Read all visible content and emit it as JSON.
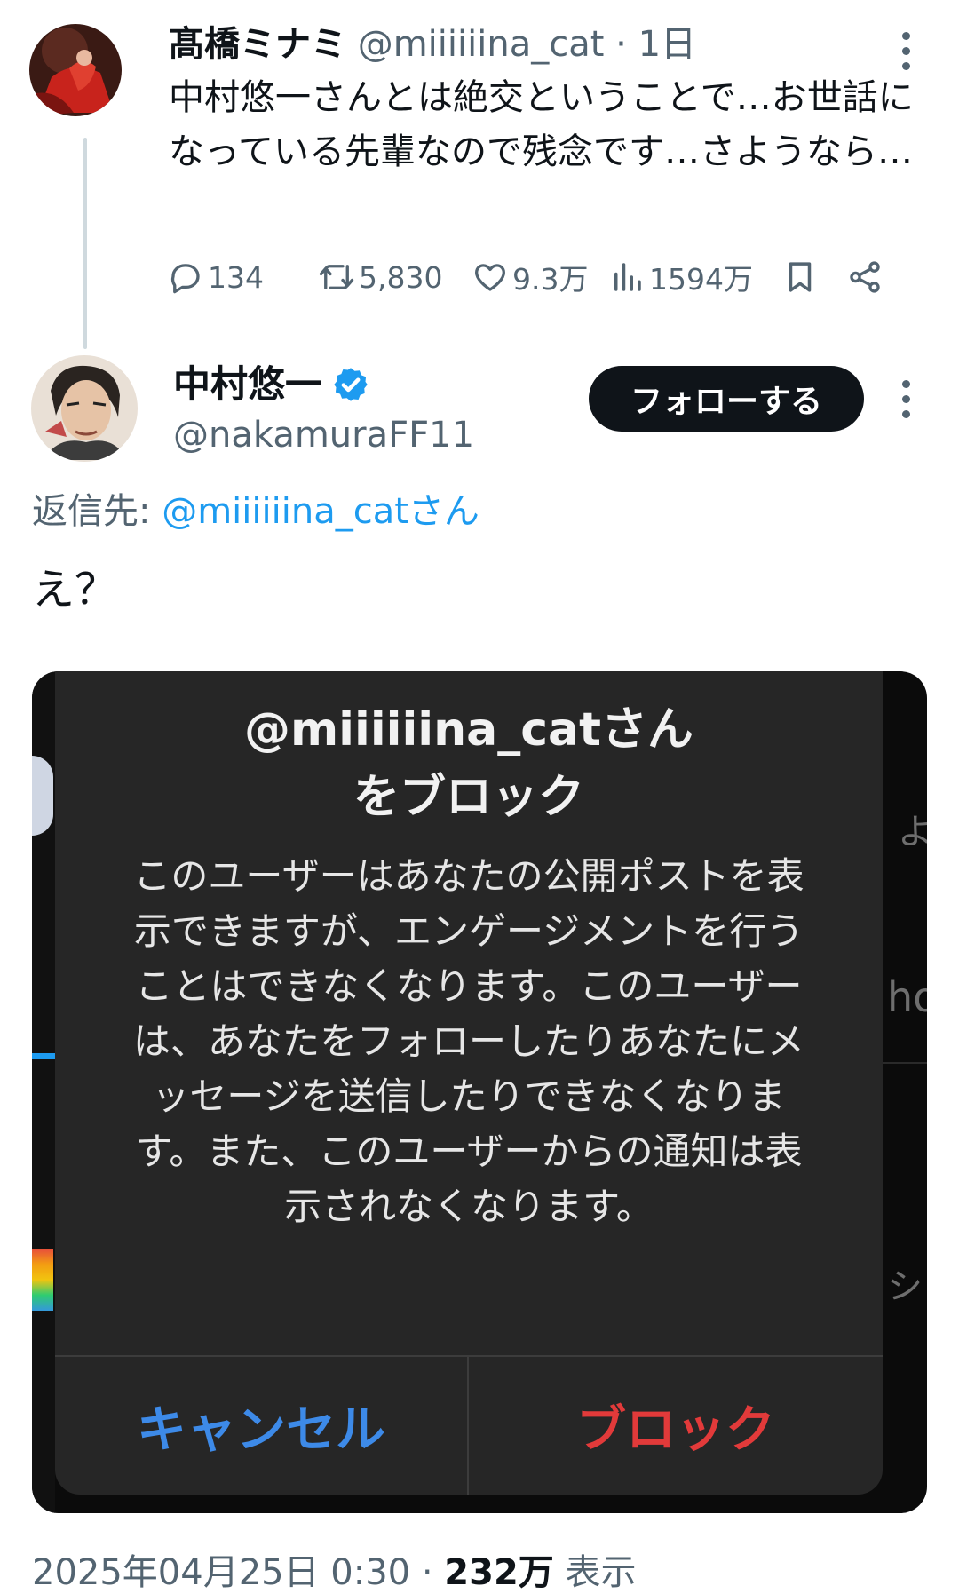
{
  "tweet1": {
    "display_name": "髙橋ミナミ",
    "handle": "@miiiiiina_cat",
    "separator": "·",
    "time": "1日",
    "text": "中村悠一さんとは絶交ということで…お世話になっている先輩なので残念です…さようなら…",
    "actions": {
      "replies": "134",
      "reposts": "5,830",
      "likes": "9.3万",
      "views": "1594万"
    }
  },
  "tweet2": {
    "display_name": "中村悠一",
    "handle": "@nakamuraFF11",
    "follow_label": "フォローする",
    "reply_prefix": "返信先:",
    "reply_target": "@miiiiiina_catさん",
    "text": "え？",
    "footer": {
      "datetime": "2025年04月25日 0:30 ·",
      "views_count": "232万",
      "views_label": "表示"
    }
  },
  "block_dialog": {
    "title_line1": "@miiiiiina_catさん",
    "title_line2": "をブロック",
    "body": "このユーザーはあなたの公開ポストを表示できますが、エンゲージメントを行うことはできなくなります。このユーザーは、あなたをフォローしたりあなたにメッセージを送信したりできなくなります。また、このユーザーからの通知は表示されなくなります。",
    "cancel_label": "キャンセル",
    "block_label": "ブロック"
  },
  "colors": {
    "link": "#1d9bf0",
    "muted": "#536471",
    "verified": "#1d9bf0",
    "cancel": "#3d8ae8",
    "block": "#e23a3a"
  },
  "icons": {
    "reply": "speech-bubble-icon",
    "repost": "repost-arrows-icon",
    "like": "heart-icon",
    "views": "bar-chart-icon",
    "bookmark": "bookmark-icon",
    "share": "share-icon",
    "more": "vertical-dots-icon",
    "verified": "verified-badge-icon"
  }
}
